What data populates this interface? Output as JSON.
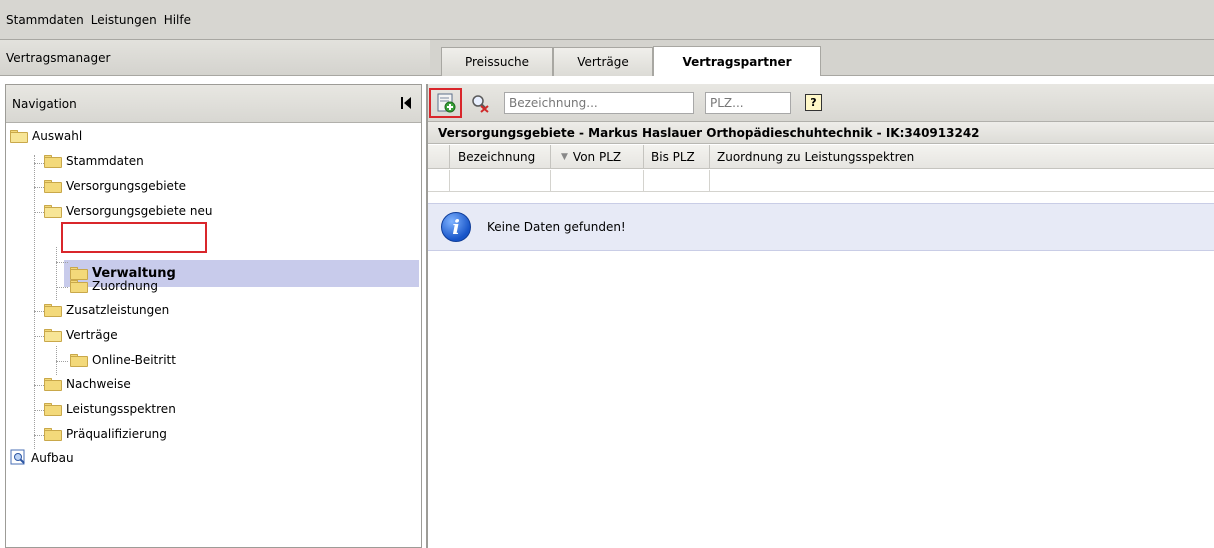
{
  "menubar": {
    "items": [
      "Stammdaten",
      "Leistungen",
      "Hilfe"
    ]
  },
  "app": {
    "title": "Vertragsmanager"
  },
  "tabs": [
    {
      "label": "Preissuche",
      "active": false
    },
    {
      "label": "Verträge",
      "active": false
    },
    {
      "label": "Vertragspartner",
      "active": true
    }
  ],
  "navigation": {
    "title": "Navigation",
    "collapse_glyph": "|◂",
    "tree": {
      "root": "Auswahl",
      "stammdaten": "Stammdaten",
      "versorgungsgebiete": "Versorgungsgebiete",
      "versorgungsgebiete_neu": "Versorgungsgebiete neu",
      "verwaltung": "Verwaltung",
      "zuordnung": "Zuordnung",
      "zusatzleistungen": "Zusatzleistungen",
      "vertraege": "Verträge",
      "online_beitritt": "Online-Beitritt",
      "nachweise": "Nachweise",
      "leistungsspektren": "Leistungsspektren",
      "praequalifizierung": "Präqualifizierung",
      "aufbau": "Aufbau"
    }
  },
  "toolbar": {
    "bezeichnung_placeholder": "Bezeichnung...",
    "plz_placeholder": "PLZ...",
    "help_glyph": "?"
  },
  "section": {
    "title": "Versorgungsgebiete - Markus Haslauer Orthopädieschuhtechnik - IK:340913242"
  },
  "table": {
    "columns": [
      "Bezeichnung",
      "Von PLZ",
      "Bis PLZ",
      "Zuordnung zu Leistungsspektren"
    ],
    "sort_glyph": "▼"
  },
  "info": {
    "glyph": "i",
    "message": "Keine Daten gefunden!"
  },
  "colors": {
    "selection": "#c8cbeb",
    "highlight_border": "#d9262b",
    "info_background": "#e7eaf6"
  }
}
